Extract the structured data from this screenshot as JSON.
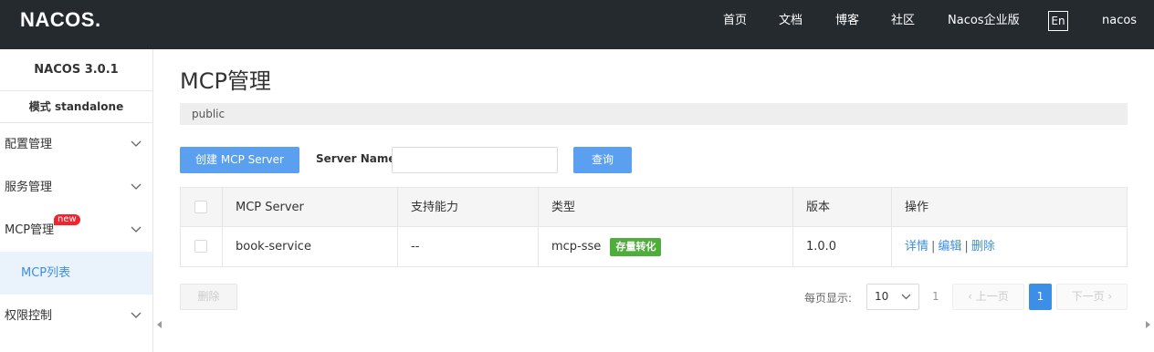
{
  "header": {
    "logo": "NACOS.",
    "nav": [
      {
        "label": "首页"
      },
      {
        "label": "文档"
      },
      {
        "label": "博客"
      },
      {
        "label": "社区"
      },
      {
        "label": "Nacos企业版"
      }
    ],
    "lang": "En",
    "user": "nacos"
  },
  "sidebar": {
    "version": "NACOS 3.0.1",
    "mode": "模式 standalone",
    "items": [
      {
        "label": "配置管理"
      },
      {
        "label": "服务管理"
      },
      {
        "label": "MCP管理",
        "badge": "new"
      },
      {
        "label": "MCP列表"
      },
      {
        "label": "权限控制"
      }
    ]
  },
  "main": {
    "title": "MCP管理",
    "namespace": "public",
    "create_button": "创建 MCP Server",
    "server_name_label": "Server Name",
    "server_name_value": "",
    "search_button": "查询",
    "table": {
      "columns": [
        "MCP Server",
        "支持能力",
        "类型",
        "版本",
        "操作"
      ],
      "rows": [
        {
          "name": "book-service",
          "capability": "--",
          "type": "mcp-sse",
          "type_tag": "存量转化",
          "version": "1.0.0",
          "ops": [
            "详情",
            "编辑",
            "删除"
          ]
        }
      ]
    },
    "delete_button": "删除",
    "pagination": {
      "page_size_label": "每页显示:",
      "page_size": "10",
      "total": "1",
      "prev": "上一页",
      "current": "1",
      "next": "下一页"
    }
  },
  "colors": {
    "header_bg": "#252a2f",
    "primary": "#5a9ff0",
    "link": "#3c8ee7",
    "tag_green": "#4fae3b",
    "badge_red": "#f5222d"
  }
}
